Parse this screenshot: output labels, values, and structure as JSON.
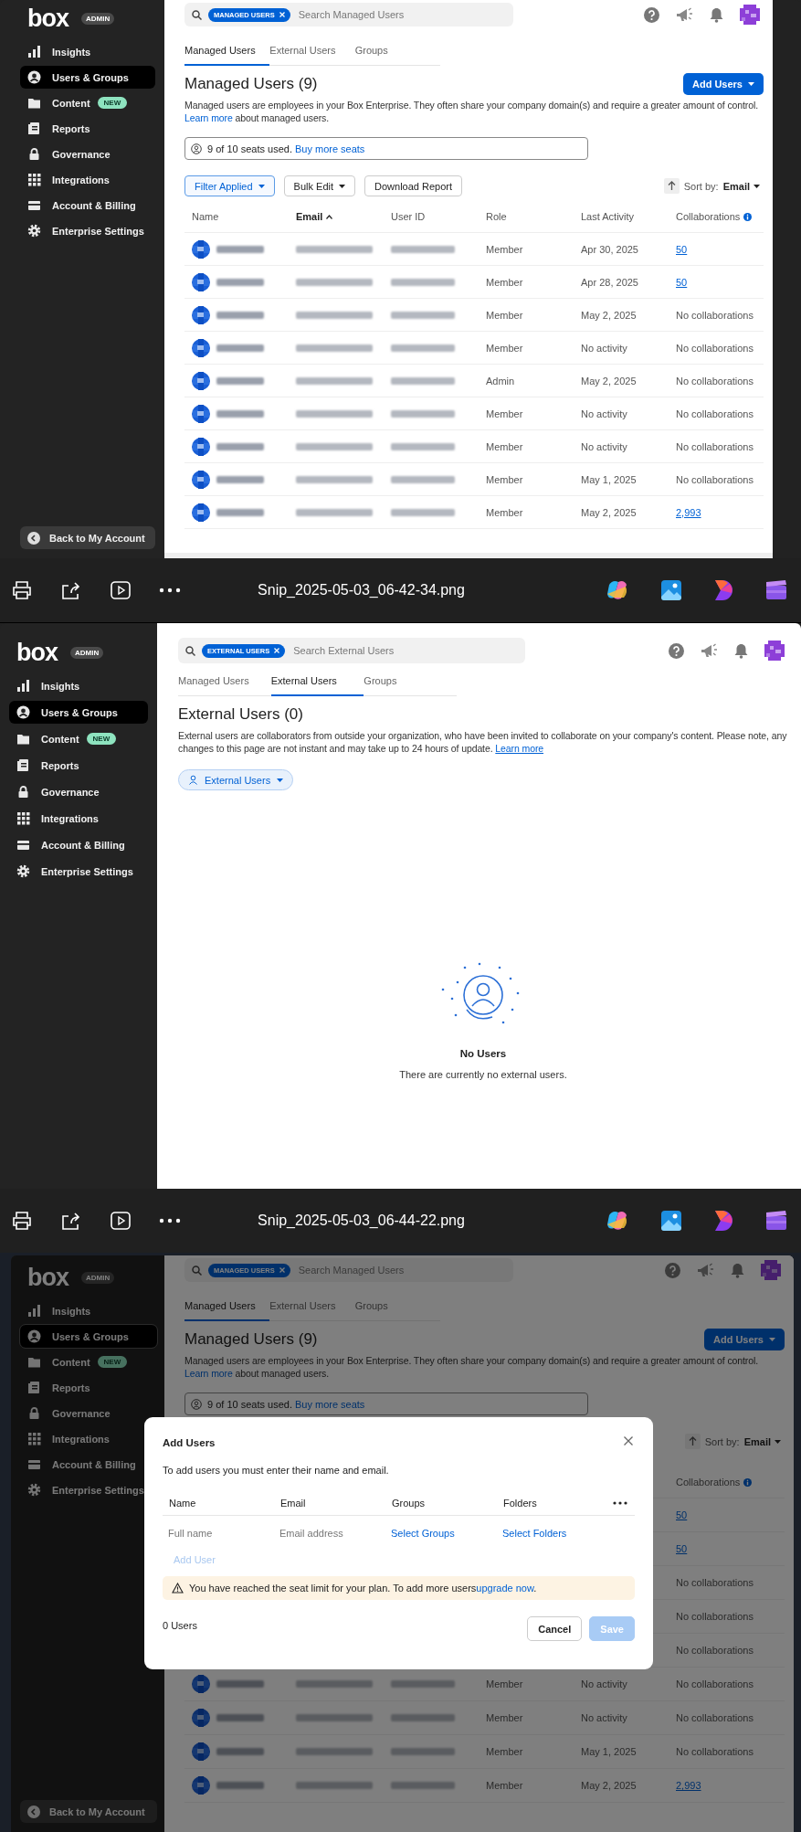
{
  "panels": [
    {
      "kind": "managed_users",
      "sidebar": {
        "logo": "box",
        "badge": "ADMIN",
        "items": [
          {
            "label": "Insights",
            "selected": false
          },
          {
            "label": "Users & Groups",
            "selected": true
          },
          {
            "label": "Content",
            "badge": "NEW",
            "selected": false
          },
          {
            "label": "Reports",
            "selected": false
          },
          {
            "label": "Governance",
            "selected": false
          },
          {
            "label": "Integrations",
            "selected": false
          },
          {
            "label": "Account & Billing",
            "selected": false
          },
          {
            "label": "Enterprise Settings",
            "selected": false
          }
        ],
        "footer": "Back to My Account"
      },
      "search": {
        "chip": "MANAGED USERS",
        "placeholder": "Search Managed Users"
      },
      "tabs": [
        {
          "label": "Managed Users",
          "selected": true
        },
        {
          "label": "External Users",
          "selected": false
        },
        {
          "label": "Groups",
          "selected": false
        }
      ],
      "title": "Managed Users (9)",
      "add_button": "Add Users",
      "description": "Managed users are employees in your Box Enterprise. They often share your company domain(s) and require a greater amount of control.",
      "description_link": "Learn more",
      "description_tail": "about managed users.",
      "seats": {
        "text": "9 of 10 seats used.",
        "link": "Buy more seats"
      },
      "toolbar": [
        {
          "label": "Filter Applied",
          "active": true,
          "dropdown": true
        },
        {
          "label": "Bulk Edit",
          "active": false,
          "dropdown": true
        },
        {
          "label": "Download Report",
          "active": false,
          "dropdown": false
        }
      ],
      "sort": {
        "label": "Sort by:",
        "value": "Email"
      },
      "header": {
        "name": {
          "label": "Name",
          "sorted": false
        },
        "email": {
          "label": "Email",
          "sorted": true
        },
        "user_id": {
          "label": "User ID",
          "sorted": false
        },
        "role": {
          "label": "Role",
          "sorted": false
        },
        "last_activity": {
          "label": "Last Activity",
          "sorted": false
        },
        "collaborations": {
          "label": "Collaborations",
          "sorted": false,
          "info": true
        }
      },
      "rows": [
        {
          "role": "Member",
          "last_activity": "Apr 30, 2025",
          "collaborations": "50",
          "link": true
        },
        {
          "role": "Member",
          "last_activity": "Apr 28, 2025",
          "collaborations": "50",
          "link": true
        },
        {
          "role": "Member",
          "last_activity": "May 2, 2025",
          "collaborations": "No collaborations",
          "link": false
        },
        {
          "role": "Member",
          "last_activity": "No activity",
          "collaborations": "No collaborations",
          "link": false
        },
        {
          "role": "Admin",
          "last_activity": "May 2, 2025",
          "collaborations": "No collaborations",
          "link": false
        },
        {
          "role": "Member",
          "last_activity": "No activity",
          "collaborations": "No collaborations",
          "link": false
        },
        {
          "role": "Member",
          "last_activity": "No activity",
          "collaborations": "No collaborations",
          "link": false
        },
        {
          "role": "Member",
          "last_activity": "May 1, 2025",
          "collaborations": "No collaborations",
          "link": false
        },
        {
          "role": "Member",
          "last_activity": "May 2, 2025",
          "collaborations": "2,993",
          "link": true
        }
      ]
    },
    {
      "kind": "viewer_bar",
      "filename": "Snip_2025-05-03_06-42-34.png"
    },
    {
      "kind": "external_users",
      "sidebar": {
        "logo": "box",
        "badge": "ADMIN",
        "items": [
          {
            "label": "Insights",
            "selected": false
          },
          {
            "label": "Users & Groups",
            "selected": true
          },
          {
            "label": "Content",
            "badge": "NEW",
            "selected": false
          },
          {
            "label": "Reports",
            "selected": false
          },
          {
            "label": "Governance",
            "selected": false
          },
          {
            "label": "Integrations",
            "selected": false
          },
          {
            "label": "Account & Billing",
            "selected": false
          },
          {
            "label": "Enterprise Settings",
            "selected": false
          }
        ]
      },
      "search": {
        "chip": "EXTERNAL USERS",
        "placeholder": "Search External Users"
      },
      "tabs": [
        {
          "label": "Managed Users",
          "selected": false
        },
        {
          "label": "External Users",
          "selected": true
        },
        {
          "label": "Groups",
          "selected": false
        }
      ],
      "title": "External Users (0)",
      "description": "External users are collaborators from outside your organization, who have been invited to collaborate on your company's content. Please note, any changes to this page are not instant and may take up to 24 hours of update.",
      "description_link": "Learn more",
      "filter": "External Users",
      "empty": {
        "title": "No Users",
        "text": "There are currently no external users."
      }
    },
    {
      "kind": "viewer_bar",
      "filename": "Snip_2025-05-03_06-44-22.png"
    },
    {
      "kind": "managed_users",
      "dimmed": true,
      "sidebar": {
        "logo": "box",
        "badge": "ADMIN",
        "items": [
          {
            "label": "Insights",
            "selected": false
          },
          {
            "label": "Users & Groups",
            "selected": true
          },
          {
            "label": "Content",
            "badge": "NEW",
            "selected": false
          },
          {
            "label": "Reports",
            "selected": false
          },
          {
            "label": "Governance",
            "selected": false
          },
          {
            "label": "Integrations",
            "selected": false
          },
          {
            "label": "Account & Billing",
            "selected": false
          },
          {
            "label": "Enterprise Settings",
            "selected": false
          }
        ],
        "footer": "Back to My Account"
      },
      "search": {
        "chip": "MANAGED USERS",
        "placeholder": "Search Managed Users"
      },
      "tabs": [
        {
          "label": "Managed Users",
          "selected": true
        },
        {
          "label": "External Users",
          "selected": false
        },
        {
          "label": "Groups",
          "selected": false
        }
      ],
      "title": "Managed Users (9)",
      "add_button": "Add Users",
      "description": "Managed users are employees in your Box Enterprise. They often share your company domain(s) and require a greater amount of control.",
      "description_link": "Learn more",
      "description_tail": "about managed users.",
      "seats": {
        "text": "9 of 10 seats used.",
        "link": "Buy more seats"
      },
      "sort": {
        "label": "Sort by:",
        "value": "Email"
      },
      "header": {
        "collaborations": {
          "label": "Collaborations",
          "sorted": false,
          "info": true
        }
      },
      "rows": [
        {
          "collaborations": "50",
          "link": true
        },
        {
          "collaborations": "50",
          "link": true
        },
        {
          "collaborations": "No collaborations",
          "link": false
        },
        {
          "collaborations": "No collaborations",
          "link": false
        },
        {
          "collaborations": "No collaborations",
          "link": false
        },
        {
          "role": "Member",
          "last_activity": "No activity",
          "collaborations": "No collaborations",
          "link": false
        },
        {
          "role": "Member",
          "last_activity": "No activity",
          "collaborations": "No collaborations",
          "link": false
        },
        {
          "role": "Member",
          "last_activity": "May 1, 2025",
          "collaborations": "No collaborations",
          "link": false
        },
        {
          "role": "Member",
          "last_activity": "May 2, 2025",
          "collaborations": "2,993",
          "link": true
        }
      ],
      "modal": {
        "title": "Add Users",
        "instructions": "To add users you must enter their name and email.",
        "columns": [
          "Name",
          "Email",
          "Groups",
          "Folders"
        ],
        "fields": [
          {
            "kind": "input",
            "placeholder": "Full name"
          },
          {
            "kind": "input",
            "placeholder": "Email address"
          },
          {
            "kind": "link",
            "label": "Select Groups"
          },
          {
            "kind": "link",
            "label": "Select Folders"
          }
        ],
        "add_user": {
          "label": "Add User",
          "disabled": true
        },
        "warning": {
          "text": "You have reached the seat limit for your plan. To add more users",
          "link": "upgrade now",
          "tail": "."
        },
        "count": "0 Users",
        "buttons": [
          {
            "label": "Cancel",
            "kind": "secondary",
            "disabled": false
          },
          {
            "label": "Save",
            "kind": "primary",
            "disabled": true
          }
        ]
      }
    }
  ]
}
